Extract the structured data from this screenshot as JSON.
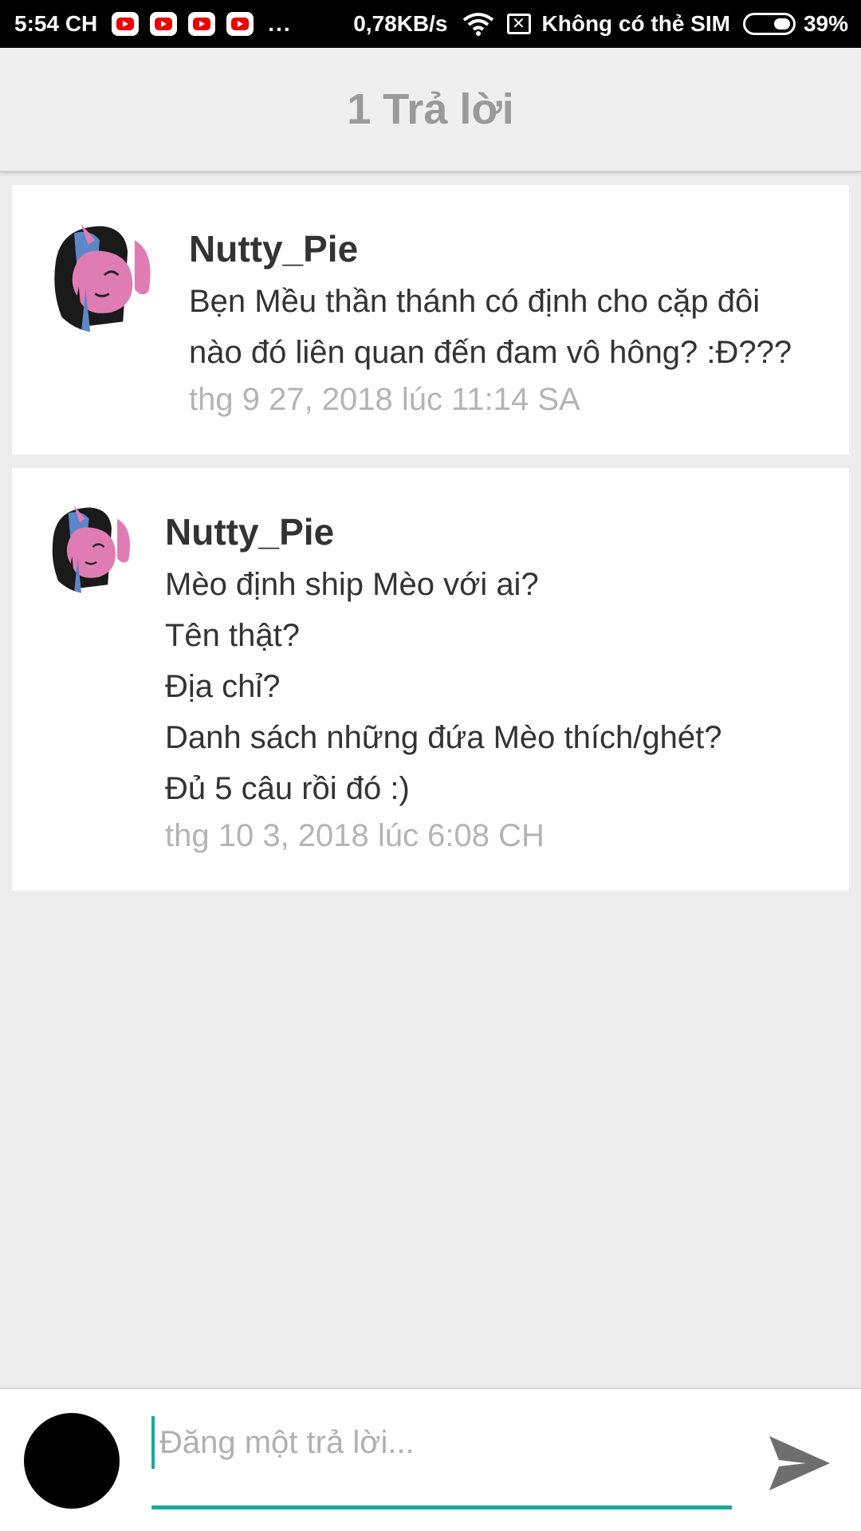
{
  "status_bar": {
    "time": "5:54 CH",
    "notification_icons": [
      "youtube-icon",
      "youtube-icon",
      "youtube-icon",
      "youtube-icon"
    ],
    "more": "...",
    "speed": "0,78KB/s",
    "sim": "Không có thẻ SIM",
    "battery": "39%",
    "battery_level": 0.39
  },
  "header": {
    "title": "1 Trả lời"
  },
  "comments": [
    {
      "author": "Nutty_Pie",
      "text": "Bẹn Mều thần thánh có định cho cặp đôi nào đó liên quan đến đam vô hông? :Đ???",
      "timestamp": "thg 9 27, 2018 lúc 11:14 SA"
    },
    {
      "author": "Nutty_Pie",
      "lines": [
        "Mèo định ship Mèo với ai?",
        "Tên thật?",
        "Địa chỉ?",
        "Danh sách những đứa Mèo thích/ghét?",
        "Đủ 5 câu rồi đó :)"
      ],
      "timestamp": "thg 10 3, 2018 lúc 6:08 CH"
    }
  ],
  "reply": {
    "placeholder": "Đăng một trả lời...",
    "value": ""
  },
  "colors": {
    "accent": "#1aa79c",
    "header_text": "#9a9a9a",
    "background": "#ececec"
  }
}
